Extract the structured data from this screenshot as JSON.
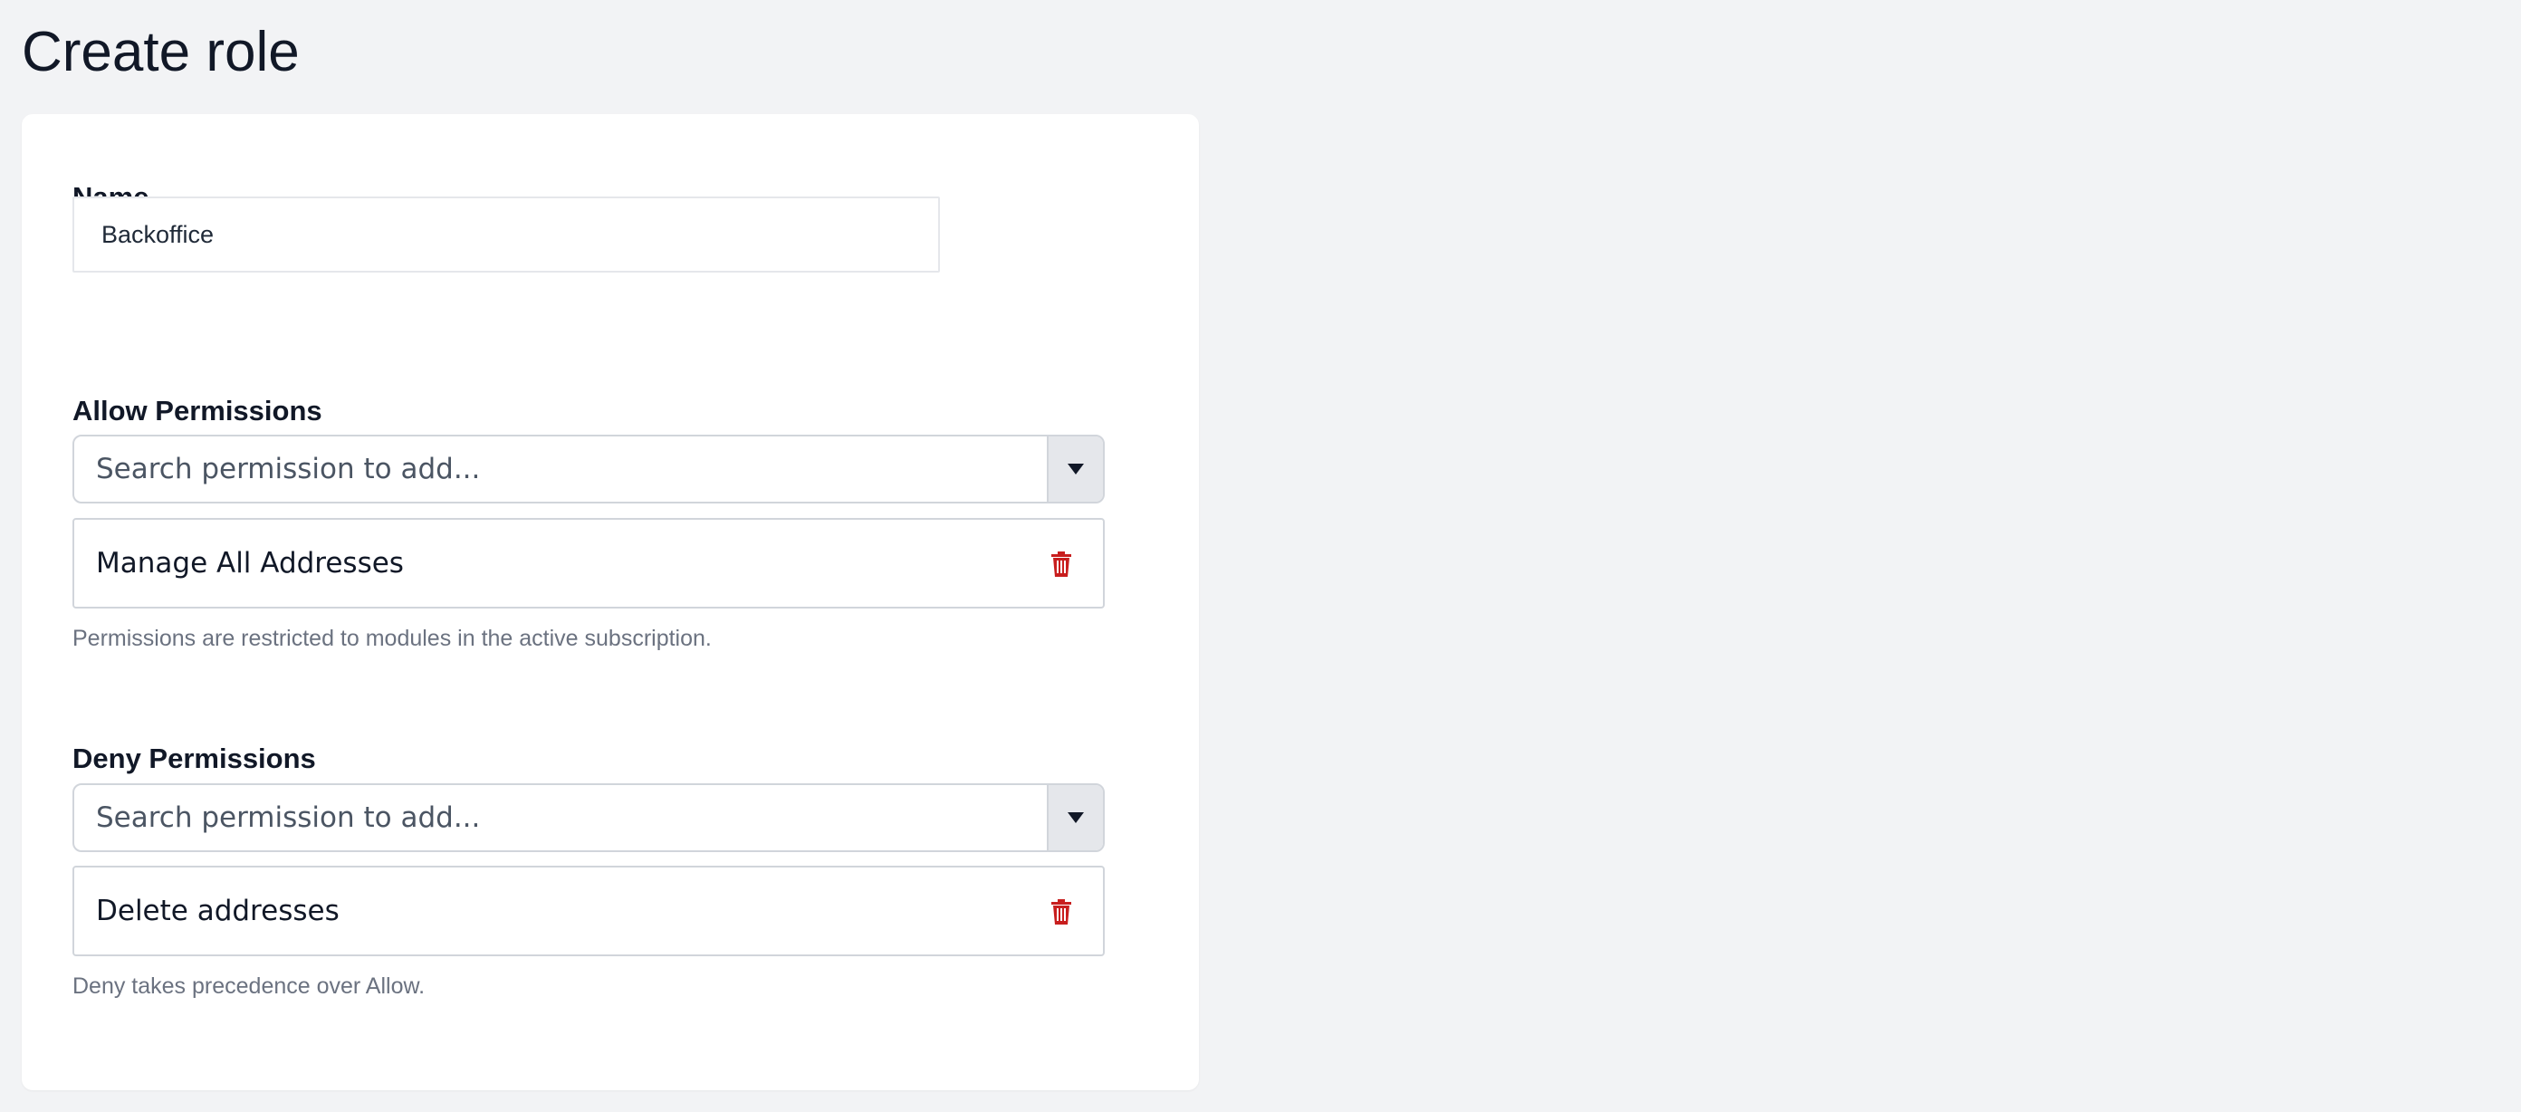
{
  "page": {
    "title": "Create role"
  },
  "form": {
    "name": {
      "label": "Name",
      "value": "Backoffice"
    },
    "allow": {
      "label": "Allow Permissions",
      "placeholder": "Search permission to add...",
      "items": [
        {
          "label": "Manage All Addresses",
          "icon": "trash-icon"
        }
      ],
      "help": "Permissions are restricted to modules in the active subscription."
    },
    "deny": {
      "label": "Deny Permissions",
      "placeholder": "Search permission to add...",
      "items": [
        {
          "label": "Delete addresses",
          "icon": "trash-icon"
        }
      ],
      "help": "Deny takes precedence over Allow."
    }
  },
  "colors": {
    "background": "#f2f3f5",
    "card": "#ffffff",
    "delete_icon": "#c81e1e",
    "help_text": "#6b7280"
  }
}
